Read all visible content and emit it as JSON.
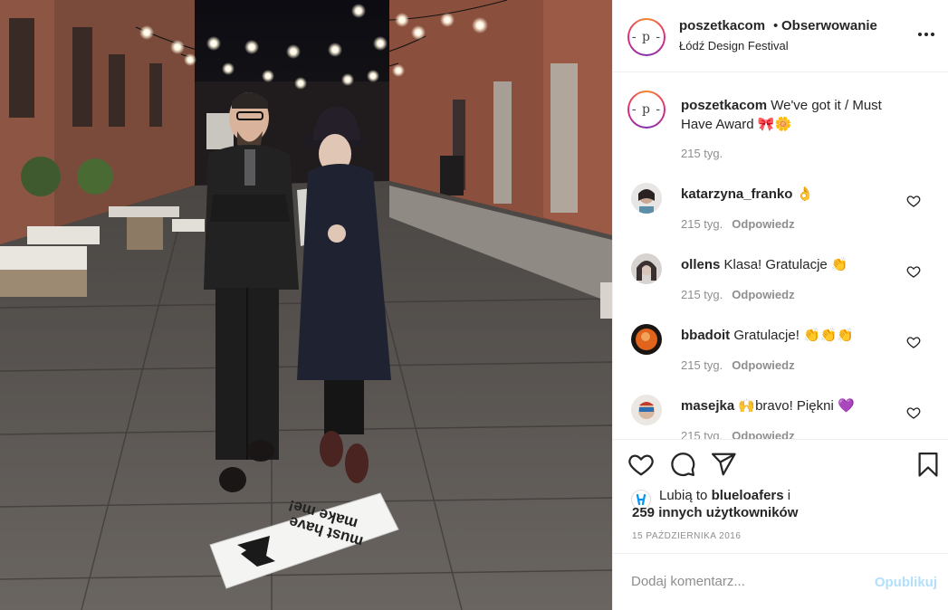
{
  "post": {
    "username": "poszetkacom",
    "dot": "•",
    "follow_label": "Obserwowanie",
    "location": "Łódź Design Festival",
    "avatar_mark": "- p -"
  },
  "caption": {
    "username": "poszetkacom",
    "text": "We've got it / Must Have Award 🎀🌼",
    "time": "215 tyg."
  },
  "comments": [
    {
      "username": "katarzyna_franko",
      "text": "👌",
      "time": "215 tyg.",
      "reply_label": "Odpowiedz"
    },
    {
      "username": "ollens",
      "text": "Klasa! Gratulacje 👏",
      "time": "215 tyg.",
      "reply_label": "Odpowiedz"
    },
    {
      "username": "bbadoit",
      "text": "Gratulacje! 👏👏👏",
      "time": "215 tyg.",
      "reply_label": "Odpowiedz"
    },
    {
      "username": "masejka",
      "text": "🙌bravo! Piękni 💜",
      "time": "215 tyg.",
      "reply_label": "Odpowiedz"
    }
  ],
  "likes": {
    "prefix": "Lubią to",
    "user": "blueloafers",
    "suffix": "i",
    "others": "259 innych użytkowników"
  },
  "date": "15 PAŹDZIERNIKA 2016",
  "add_comment": {
    "placeholder": "Dodaj komentarz...",
    "post_label": "Opublikuj"
  },
  "photo": {
    "sign_text_line1": "must have",
    "sign_text_line2": "make me!"
  },
  "colors": {
    "link_disabled": "#b2dffc",
    "secondary_text": "#8e8e8e",
    "border": "#efefef",
    "likes_icon_blue": "#0095f6"
  },
  "icons": [
    "heart-icon",
    "comment-icon",
    "share-icon",
    "bookmark-icon",
    "more-icon",
    "comment-like-heart-icon"
  ]
}
